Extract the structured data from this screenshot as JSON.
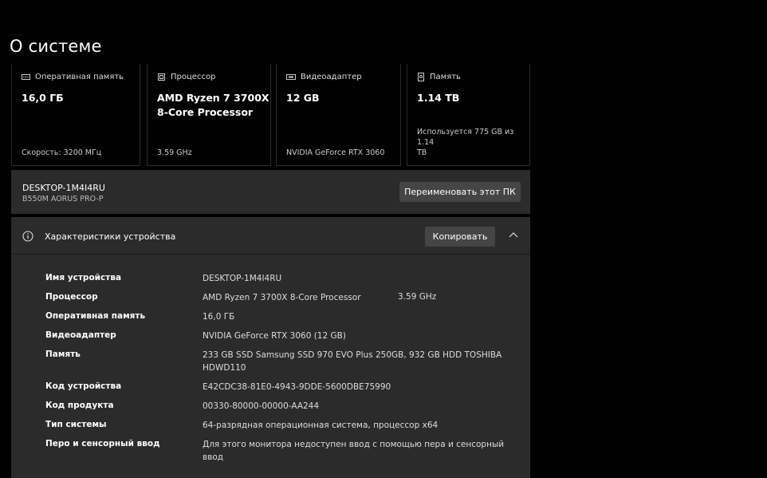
{
  "page": {
    "title": "О системе"
  },
  "cards": [
    {
      "icon": "ram-icon",
      "header": "Оперативная память",
      "value": "16,0 ГБ",
      "sub": "Скорость: 3200 МГц"
    },
    {
      "icon": "processor-icon",
      "header": "Процессор",
      "value_line1": "AMD Ryzen 7 3700X",
      "value_line2": "8-Core Processor",
      "sub": "3.59 GHz"
    },
    {
      "icon": "gpu-icon",
      "header": "Видеоадаптер",
      "value": "12 GB",
      "sub": "NVIDIA GeForce RTX 3060"
    },
    {
      "icon": "storage-icon",
      "header": "Память",
      "value": "1.14 TB",
      "sub_line1": "Используется 775 GB из 1.14",
      "sub_line2": "TB"
    }
  ],
  "device": {
    "name": "DESKTOP-1M4I4RU",
    "model": "B550M AORUS PRO-P",
    "rename_label": "Переименовать этот ПК"
  },
  "specs": {
    "title": "Характеристики устройства",
    "copy_label": "Копировать",
    "rows": [
      {
        "key": "Имя устройства",
        "value": "DESKTOP-1M4I4RU"
      },
      {
        "key": "Процессор",
        "value": "AMD Ryzen 7 3700X 8-Core Processor",
        "value2": "3.59 GHz"
      },
      {
        "key": "Оперативная память",
        "value": "16,0 ГБ"
      },
      {
        "key": "Видеоадаптер",
        "value": "NVIDIA GeForce RTX 3060 (12 GB)"
      },
      {
        "key": "Память",
        "value": "233 GB SSD Samsung SSD 970 EVO Plus 250GB, 932 GB HDD TOSHIBA HDWD110"
      },
      {
        "key": "Код устройства",
        "value": "E42CDC38-81E0-4943-9DDE-5600DBE75990"
      },
      {
        "key": "Код продукта",
        "value": "00330-80000-00000-AA244"
      },
      {
        "key": "Тип системы",
        "value": "64-разрядная операционная система, процессор x64"
      },
      {
        "key": "Перо и сенсорный ввод",
        "value": "Для этого монитора недоступен ввод с помощью пера и сенсорный ввод"
      }
    ]
  }
}
